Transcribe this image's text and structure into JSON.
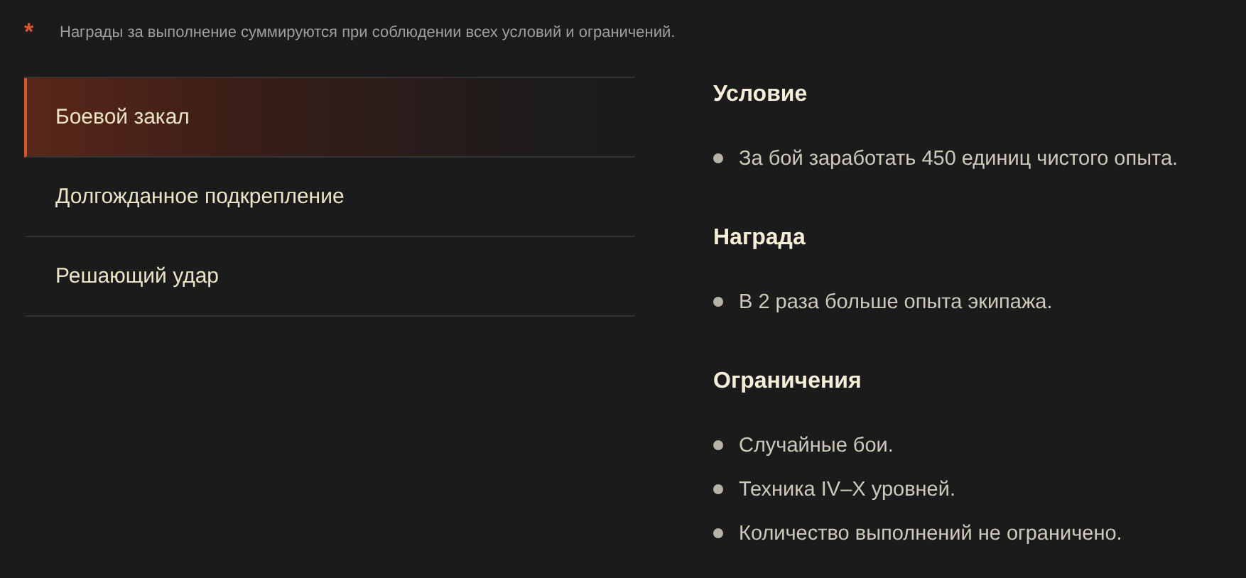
{
  "note": {
    "mark": "*",
    "text": "Награды за выполнение суммируются при соблюдении всех условий и ограничений."
  },
  "missions": [
    {
      "label": "Боевой закал",
      "selected": true
    },
    {
      "label": "Долгожданное подкрепление",
      "selected": false
    },
    {
      "label": "Решающий удар",
      "selected": false
    }
  ],
  "sections": [
    {
      "title": "Условие",
      "items": [
        "За бой заработать 450 единиц чистого опыта."
      ]
    },
    {
      "title": "Награда",
      "items": [
        "В 2 раза больше опыта экипажа."
      ]
    },
    {
      "title": "Ограничения",
      "items": [
        "Случайные бои.",
        "Техника IV–X уровней.",
        "Количество выполнений не ограничено."
      ]
    }
  ]
}
